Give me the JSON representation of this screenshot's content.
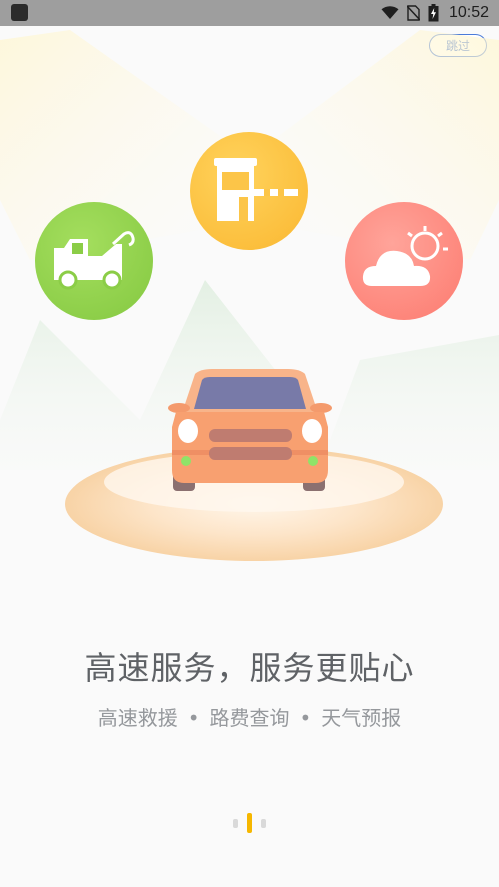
{
  "status_bar": {
    "time": "10:52",
    "icons": [
      "app-icon",
      "wifi-icon",
      "no-sim-icon",
      "battery-charging-icon"
    ]
  },
  "skip_button": {
    "label": "跳过"
  },
  "illustration": {
    "icons": [
      "tow-truck-icon",
      "toll-gate-icon",
      "weather-icon",
      "car-icon"
    ],
    "colors": {
      "green": "#8fd14f",
      "yellow": "#fdc646",
      "red": "#ff8c82",
      "car_body": "#f8a070",
      "car_window": "#7a7aa6"
    }
  },
  "headline": "高速服务，服务更贴心",
  "features": [
    "高速救援",
    "路费查询",
    "天气预报"
  ],
  "separator": "•",
  "pager": {
    "count": 3,
    "active_index": 1
  }
}
